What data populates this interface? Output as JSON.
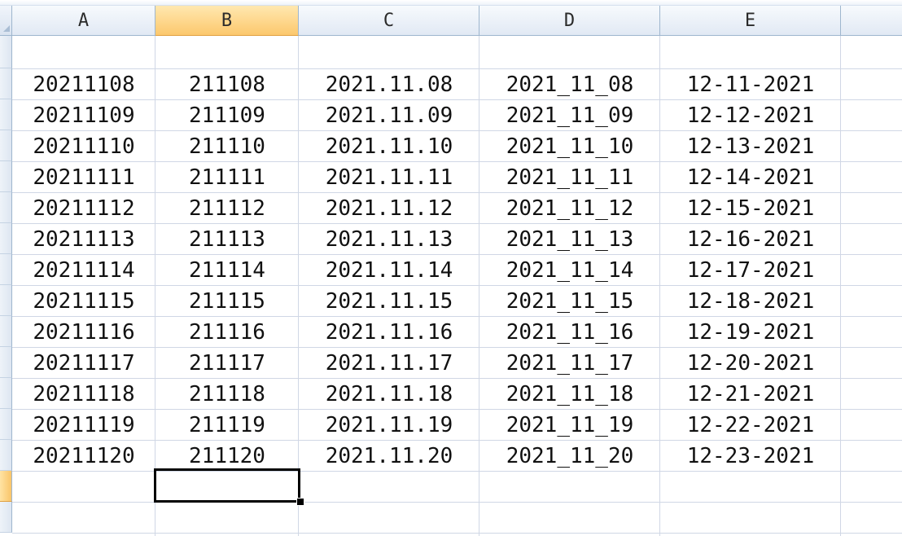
{
  "columns": [
    "A",
    "B",
    "C",
    "D",
    "E"
  ],
  "selected_column": "B",
  "rows": [
    [
      "20211108",
      "211108",
      "2021.11.08",
      "2021_11_08",
      "12-11-2021"
    ],
    [
      "20211109",
      "211109",
      "2021.11.09",
      "2021_11_09",
      "12-12-2021"
    ],
    [
      "20211110",
      "211110",
      "2021.11.10",
      "2021_11_10",
      "12-13-2021"
    ],
    [
      "20211111",
      "211111",
      "2021.11.11",
      "2021_11_11",
      "12-14-2021"
    ],
    [
      "20211112",
      "211112",
      "2021.11.12",
      "2021_11_12",
      "12-15-2021"
    ],
    [
      "20211113",
      "211113",
      "2021.11.13",
      "2021_11_13",
      "12-16-2021"
    ],
    [
      "20211114",
      "211114",
      "2021.11.14",
      "2021_11_14",
      "12-17-2021"
    ],
    [
      "20211115",
      "211115",
      "2021.11.15",
      "2021_11_15",
      "12-18-2021"
    ],
    [
      "20211116",
      "211116",
      "2021.11.16",
      "2021_11_16",
      "12-19-2021"
    ],
    [
      "20211117",
      "211117",
      "2021.11.17",
      "2021_11_17",
      "12-20-2021"
    ],
    [
      "20211118",
      "211118",
      "2021.11.18",
      "2021_11_18",
      "12-21-2021"
    ],
    [
      "20211119",
      "211119",
      "2021.11.19",
      "2021_11_19",
      "12-22-2021"
    ],
    [
      "20211120",
      "211120",
      "2021.11.20",
      "2021_11_20",
      "12-23-2021"
    ]
  ],
  "colors": {
    "selected_header": "#fcc86d",
    "grid_line": "#d0d7e5",
    "active_cell_border": "#000000"
  }
}
